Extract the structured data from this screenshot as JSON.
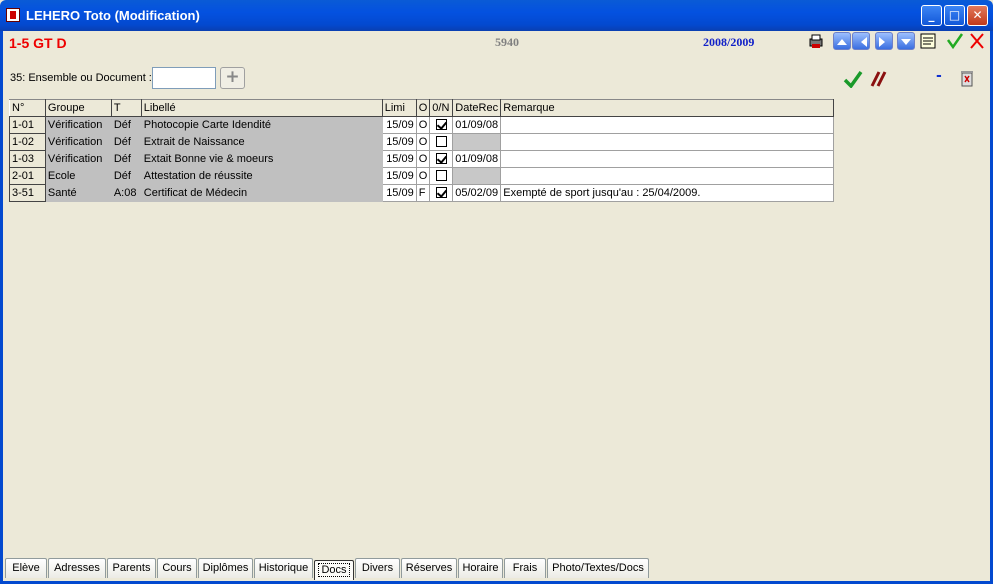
{
  "window": {
    "title": "LEHERO Toto (Modification)"
  },
  "header": {
    "code": "1-5 GT D",
    "number": "5940",
    "year": "2008/2009"
  },
  "filter": {
    "label": "35: Ensemble ou Document :",
    "value": "",
    "add": "+"
  },
  "actions": {
    "minus": "-"
  },
  "columns": [
    "N°",
    "Groupe",
    "T",
    "Libellé",
    "Limi",
    "O",
    "0/N",
    "DateRec",
    "Remarque"
  ],
  "rows": [
    {
      "n": "1-01",
      "groupe": "Vérification",
      "t": "Déf",
      "libelle": "Photocopie Carte Idendité",
      "limi": "15/09",
      "o": "O",
      "checked": true,
      "date": "01/09/08",
      "remarque": ""
    },
    {
      "n": "1-02",
      "groupe": "Vérification",
      "t": "Déf",
      "libelle": "Extrait de Naissance",
      "limi": "15/09",
      "o": "O",
      "checked": false,
      "date": "",
      "remarque": ""
    },
    {
      "n": "1-03",
      "groupe": "Vérification",
      "t": "Déf",
      "libelle": "Extait Bonne vie & moeurs",
      "limi": "15/09",
      "o": "O",
      "checked": true,
      "date": "01/09/08",
      "remarque": ""
    },
    {
      "n": "2-01",
      "groupe": "Ecole",
      "t": "Déf",
      "libelle": "Attestation de réussite",
      "limi": "15/09",
      "o": "O",
      "checked": false,
      "date": "",
      "remarque": ""
    },
    {
      "n": "3-51",
      "groupe": "Santé",
      "t": "A:08",
      "libelle": "Certificat de Médecin",
      "limi": "15/09",
      "o": "F",
      "checked": true,
      "date": "05/02/09",
      "remarque": "Exempté de sport jusqu'au : 25/04/2009."
    }
  ],
  "tabs": [
    "Elève",
    "Adresses",
    "Parents",
    "Cours",
    "Diplômes",
    "Historique",
    "Docs",
    "Divers",
    "Réserves",
    "Horaire",
    "Frais",
    "Photo/Textes/Docs"
  ],
  "active_tab": "Docs",
  "colors": {
    "title_blue": "#0349cf",
    "code_red": "#e00000",
    "year_blue": "#1020c8",
    "row_gray": "#c0c0c0"
  }
}
